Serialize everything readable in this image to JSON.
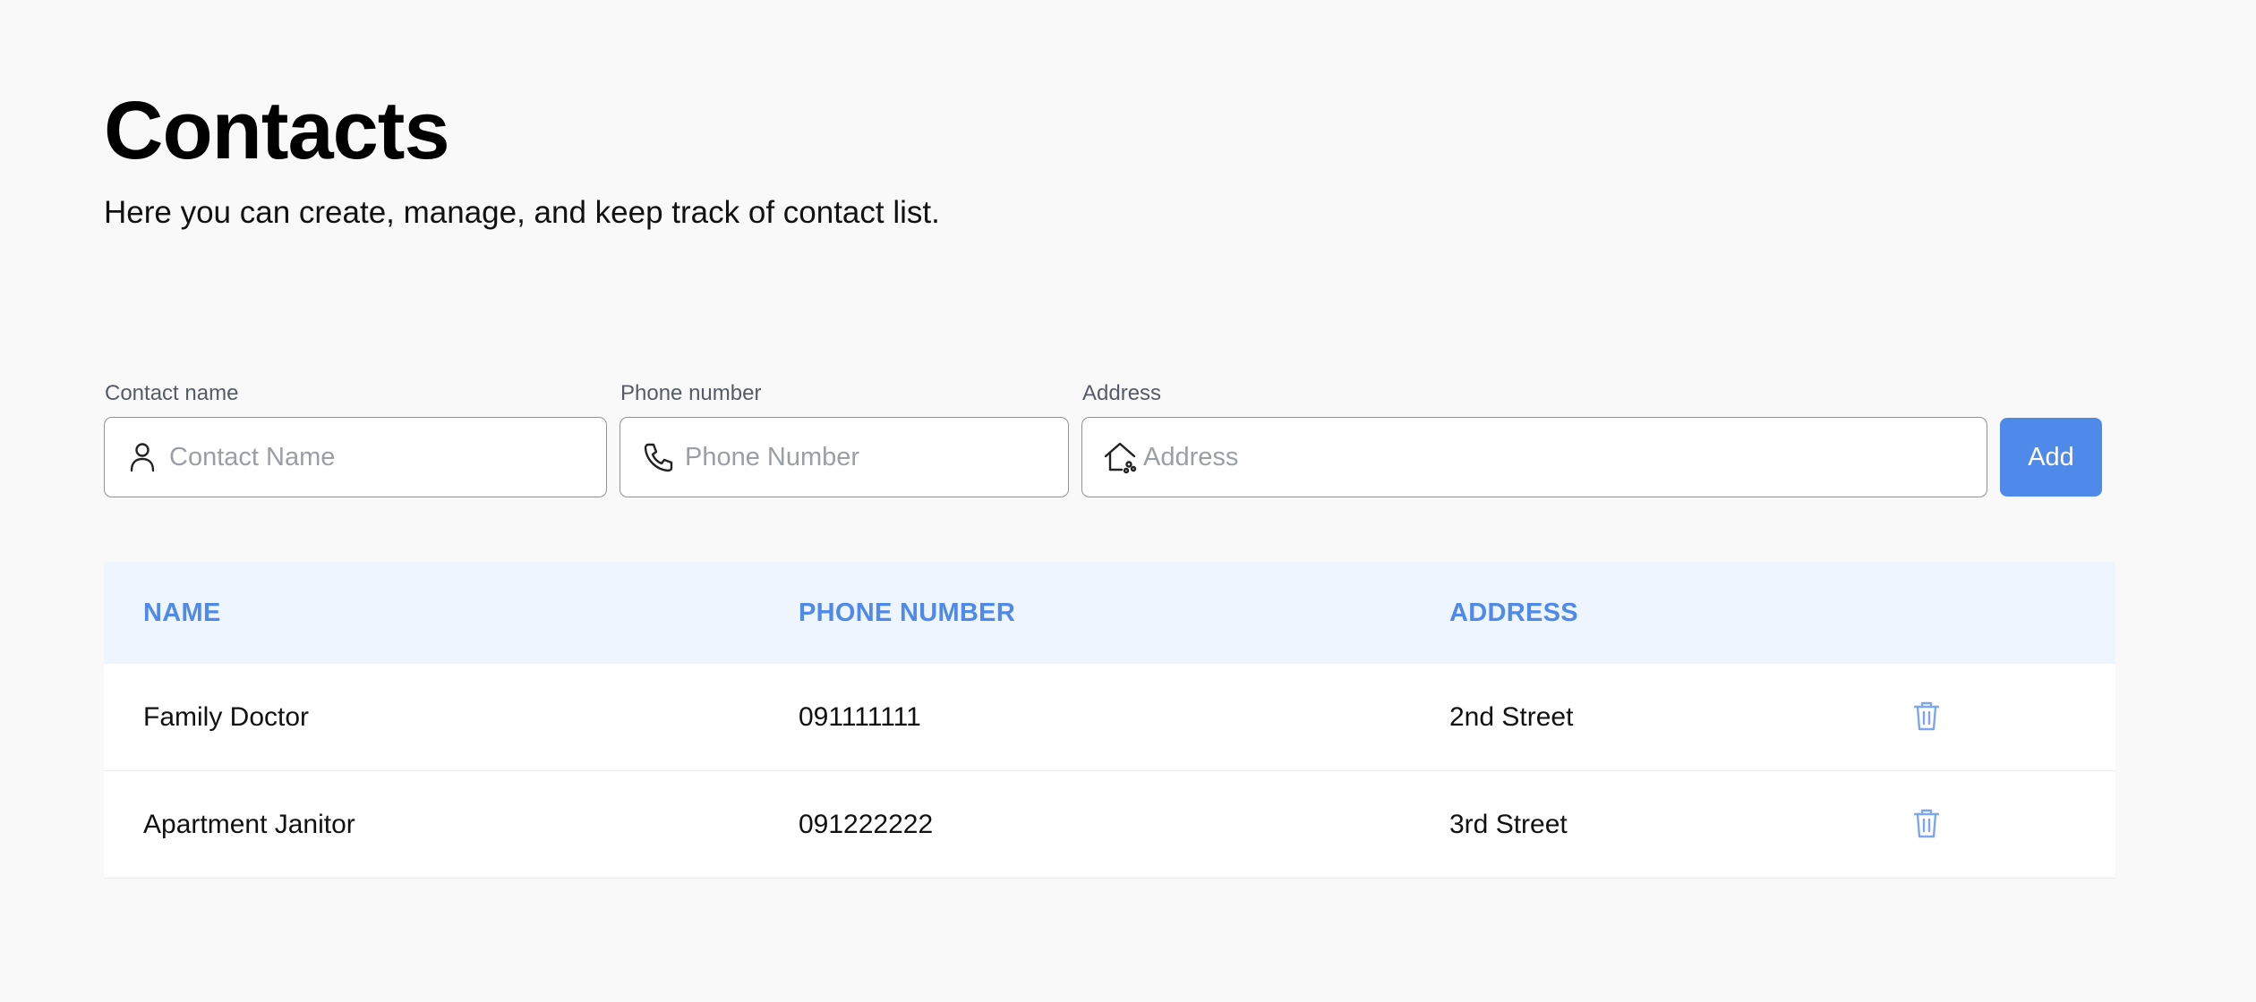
{
  "header": {
    "title": "Contacts",
    "subtitle": "Here you can create, manage, and keep track of contact list."
  },
  "form": {
    "name": {
      "label": "Contact name",
      "placeholder": "Contact Name",
      "value": "",
      "icon": "person-icon"
    },
    "phone": {
      "label": "Phone number",
      "placeholder": "Phone Number",
      "value": "",
      "icon": "phone-icon"
    },
    "address": {
      "label": "Address",
      "placeholder": "Address",
      "value": "",
      "icon": "house-icon"
    },
    "add_label": "Add"
  },
  "table": {
    "headers": {
      "name": "NAME",
      "phone": "PHONE NUMBER",
      "address": "ADDRESS"
    },
    "rows": [
      {
        "name": "Family Doctor",
        "phone": "091111111",
        "address": "2nd Street"
      },
      {
        "name": "Apartment Janitor",
        "phone": "091222222",
        "address": "3rd Street"
      }
    ]
  },
  "colors": {
    "accent": "#4f89ea",
    "header_bg": "#eef5fe",
    "page_bg": "#f9f9f9"
  }
}
